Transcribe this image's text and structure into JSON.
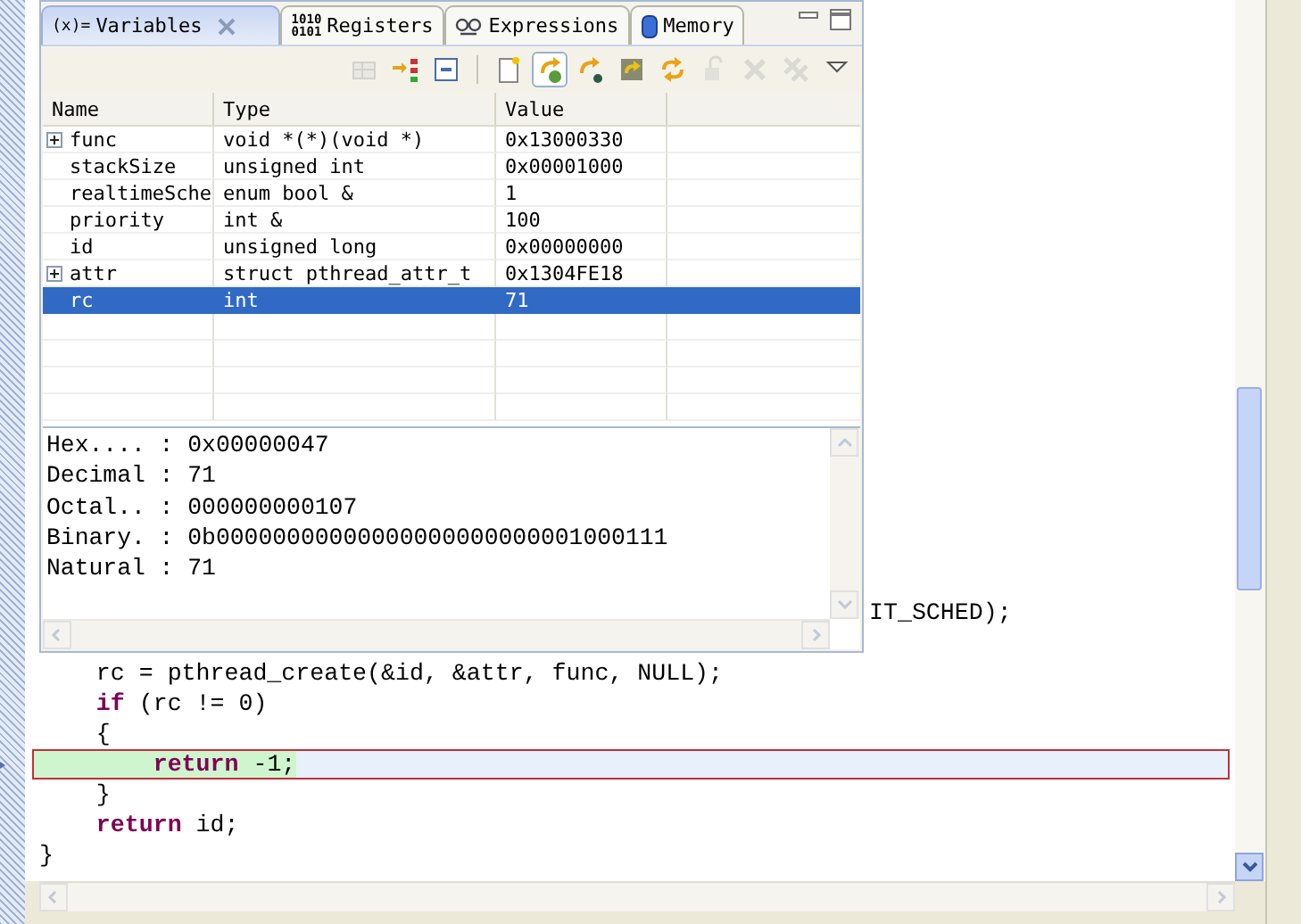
{
  "view": {
    "tabs": [
      {
        "label": "Variables",
        "kind": "variables",
        "icon_lines": [
          "(x)="
        ],
        "selected": true,
        "closable": true
      },
      {
        "label": "Registers",
        "kind": "registers",
        "icon_lines": [
          "1010",
          "0101"
        ],
        "selected": false,
        "closable": false
      },
      {
        "label": "Expressions",
        "kind": "expressions",
        "selected": false,
        "closable": false
      },
      {
        "label": "Memory",
        "kind": "memory",
        "selected": false,
        "closable": false
      }
    ],
    "toolbar": [
      {
        "kind": "grid",
        "disabled": true,
        "pressed": false
      },
      {
        "kind": "arrow-tree",
        "disabled": false,
        "pressed": false
      },
      {
        "kind": "collapse",
        "disabled": false,
        "pressed": false
      },
      {
        "kind": "separator"
      },
      {
        "kind": "page",
        "disabled": false,
        "pressed": false
      },
      {
        "kind": "arrow-gear",
        "disabled": false,
        "pressed": true
      },
      {
        "kind": "arrow-dot",
        "disabled": false,
        "pressed": false
      },
      {
        "kind": "arrow-box",
        "disabled": false,
        "pressed": false
      },
      {
        "kind": "arrows-circle",
        "disabled": false,
        "pressed": false
      },
      {
        "kind": "lock",
        "disabled": true,
        "pressed": false
      },
      {
        "kind": "remove",
        "disabled": true,
        "pressed": false
      },
      {
        "kind": "remove-all",
        "disabled": true,
        "pressed": false
      },
      {
        "kind": "menu",
        "disabled": false,
        "pressed": false
      }
    ],
    "table": {
      "columns": [
        "Name",
        "Type",
        "Value"
      ],
      "rows": [
        {
          "name": "func",
          "type": "void *(*)(void *)",
          "value": "0x13000330",
          "expandable": true,
          "selected": false
        },
        {
          "name": "stackSize",
          "type": "unsigned int",
          "value": "0x00001000",
          "expandable": false,
          "selected": false
        },
        {
          "name": "realtimeSche",
          "type": "enum bool &",
          "value": "1",
          "expandable": false,
          "selected": false
        },
        {
          "name": "priority",
          "type": "int &",
          "value": "100",
          "expandable": false,
          "selected": false
        },
        {
          "name": "id",
          "type": "unsigned long",
          "value": "0x00000000",
          "expandable": false,
          "selected": false
        },
        {
          "name": "attr",
          "type": "struct pthread_attr_t",
          "value": "0x1304FE18",
          "expandable": true,
          "selected": false
        },
        {
          "name": "rc",
          "type": "int",
          "value": "71",
          "expandable": false,
          "selected": true
        }
      ]
    },
    "details": [
      "Hex.... : 0x00000047",
      "Decimal : 71",
      "Octal.. : 000000000107",
      "Binary. : 0b00000000000000000000000001000111",
      "Natural : 71"
    ]
  },
  "editor": {
    "lines": [
      {
        "text": "IT_SCHED);",
        "kind": "partial",
        "current": false
      },
      {
        "text": "    rc = pthread_create(&id, &attr, func, NULL);",
        "kind": "code",
        "current": false
      },
      {
        "text": "    **if** (rc != 0)",
        "kind": "code",
        "current": false
      },
      {
        "text": "    {",
        "kind": "code",
        "current": false
      },
      {
        "text": "        **return** -1;",
        "kind": "code",
        "current": true
      },
      {
        "text": "    }",
        "kind": "code",
        "current": false
      },
      {
        "text": "    **return** id;",
        "kind": "code",
        "current": false
      },
      {
        "text": "}",
        "kind": "code",
        "current": false
      }
    ]
  }
}
